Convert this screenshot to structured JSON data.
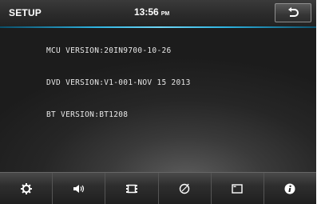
{
  "header": {
    "title": "SETUP",
    "time": "13:56",
    "ampm": "PM"
  },
  "info": {
    "mcu_version": "MCU VERSION:20IN9700-10-26",
    "dvd_version": "DVD VERSION:V1-001-NOV 15 2013",
    "bt_version": "BT VERSION:BT1208"
  },
  "navbar": {
    "items": [
      {
        "icon": "gear-icon"
      },
      {
        "icon": "speaker-icon"
      },
      {
        "icon": "film-icon"
      },
      {
        "icon": "compass-icon"
      },
      {
        "icon": "screen-icon"
      },
      {
        "icon": "info-icon"
      }
    ]
  },
  "colors": {
    "accent": "#2fb3e0",
    "background": "#262626",
    "text": "#ffffff"
  }
}
